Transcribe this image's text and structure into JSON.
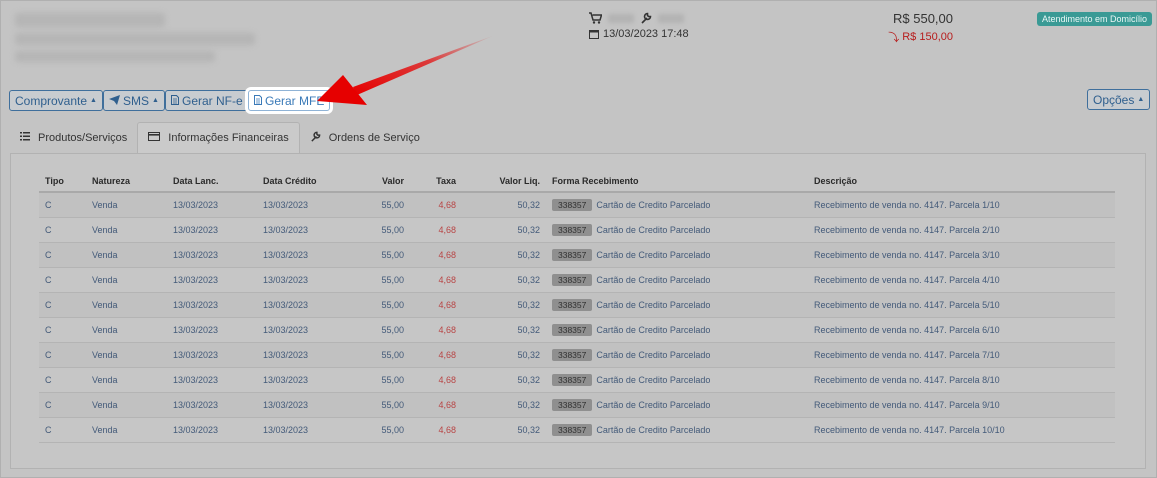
{
  "header": {
    "date": "13/03/2023 17:48",
    "total": "R$ 550,00",
    "sub_total": "R$ 150,00",
    "badge": "Atendimento em Domicílio"
  },
  "actions": {
    "comprovante": "Comprovante",
    "sms": "SMS",
    "gerar_nfe": "Gerar NF-e",
    "gerar_mfe": "Gerar MFE",
    "opcoes": "Opções"
  },
  "tabs": [
    {
      "label": "Produtos/Serviços",
      "icon": "list-icon"
    },
    {
      "label": "Informações Financeiras",
      "icon": "credit-card-icon"
    },
    {
      "label": "Ordens de Serviço",
      "icon": "wrench-icon"
    }
  ],
  "table": {
    "headers": [
      "Tipo",
      "Natureza",
      "Data Lanc.",
      "Data Crédito",
      "Valor",
      "Taxa",
      "Valor Liq.",
      "Forma Recebimento",
      "Descrição"
    ],
    "rows": [
      {
        "tipo": "C",
        "natureza": "Venda",
        "data_lanc": "13/03/2023",
        "data_credito": "13/03/2023",
        "valor": "55,00",
        "taxa": "4,68",
        "valor_liq": "50,32",
        "codigo": "338357",
        "forma": "Cartão de Credito Parcelado",
        "descricao": "Recebimento de venda no. 4147. Parcela 1/10"
      },
      {
        "tipo": "C",
        "natureza": "Venda",
        "data_lanc": "13/03/2023",
        "data_credito": "13/03/2023",
        "valor": "55,00",
        "taxa": "4,68",
        "valor_liq": "50,32",
        "codigo": "338357",
        "forma": "Cartão de Credito Parcelado",
        "descricao": "Recebimento de venda no. 4147. Parcela 2/10"
      },
      {
        "tipo": "C",
        "natureza": "Venda",
        "data_lanc": "13/03/2023",
        "data_credito": "13/03/2023",
        "valor": "55,00",
        "taxa": "4,68",
        "valor_liq": "50,32",
        "codigo": "338357",
        "forma": "Cartão de Credito Parcelado",
        "descricao": "Recebimento de venda no. 4147. Parcela 3/10"
      },
      {
        "tipo": "C",
        "natureza": "Venda",
        "data_lanc": "13/03/2023",
        "data_credito": "13/03/2023",
        "valor": "55,00",
        "taxa": "4,68",
        "valor_liq": "50,32",
        "codigo": "338357",
        "forma": "Cartão de Credito Parcelado",
        "descricao": "Recebimento de venda no. 4147. Parcela 4/10"
      },
      {
        "tipo": "C",
        "natureza": "Venda",
        "data_lanc": "13/03/2023",
        "data_credito": "13/03/2023",
        "valor": "55,00",
        "taxa": "4,68",
        "valor_liq": "50,32",
        "codigo": "338357",
        "forma": "Cartão de Credito Parcelado",
        "descricao": "Recebimento de venda no. 4147. Parcela 5/10"
      },
      {
        "tipo": "C",
        "natureza": "Venda",
        "data_lanc": "13/03/2023",
        "data_credito": "13/03/2023",
        "valor": "55,00",
        "taxa": "4,68",
        "valor_liq": "50,32",
        "codigo": "338357",
        "forma": "Cartão de Credito Parcelado",
        "descricao": "Recebimento de venda no. 4147. Parcela 6/10"
      },
      {
        "tipo": "C",
        "natureza": "Venda",
        "data_lanc": "13/03/2023",
        "data_credito": "13/03/2023",
        "valor": "55,00",
        "taxa": "4,68",
        "valor_liq": "50,32",
        "codigo": "338357",
        "forma": "Cartão de Credito Parcelado",
        "descricao": "Recebimento de venda no. 4147. Parcela 7/10"
      },
      {
        "tipo": "C",
        "natureza": "Venda",
        "data_lanc": "13/03/2023",
        "data_credito": "13/03/2023",
        "valor": "55,00",
        "taxa": "4,68",
        "valor_liq": "50,32",
        "codigo": "338357",
        "forma": "Cartão de Credito Parcelado",
        "descricao": "Recebimento de venda no. 4147. Parcela 8/10"
      },
      {
        "tipo": "C",
        "natureza": "Venda",
        "data_lanc": "13/03/2023",
        "data_credito": "13/03/2023",
        "valor": "55,00",
        "taxa": "4,68",
        "valor_liq": "50,32",
        "codigo": "338357",
        "forma": "Cartão de Credito Parcelado",
        "descricao": "Recebimento de venda no. 4147. Parcela 9/10"
      },
      {
        "tipo": "C",
        "natureza": "Venda",
        "data_lanc": "13/03/2023",
        "data_credito": "13/03/2023",
        "valor": "55,00",
        "taxa": "4,68",
        "valor_liq": "50,32",
        "codigo": "338357",
        "forma": "Cartão de Credito Parcelado",
        "descricao": "Recebimento de venda no. 4147. Parcela 10/10"
      }
    ]
  },
  "colors": {
    "accent": "#2f5f8e",
    "badge": "#3a9a95",
    "negative": "#b71c1c",
    "annotation_arrow": "#e60000"
  }
}
